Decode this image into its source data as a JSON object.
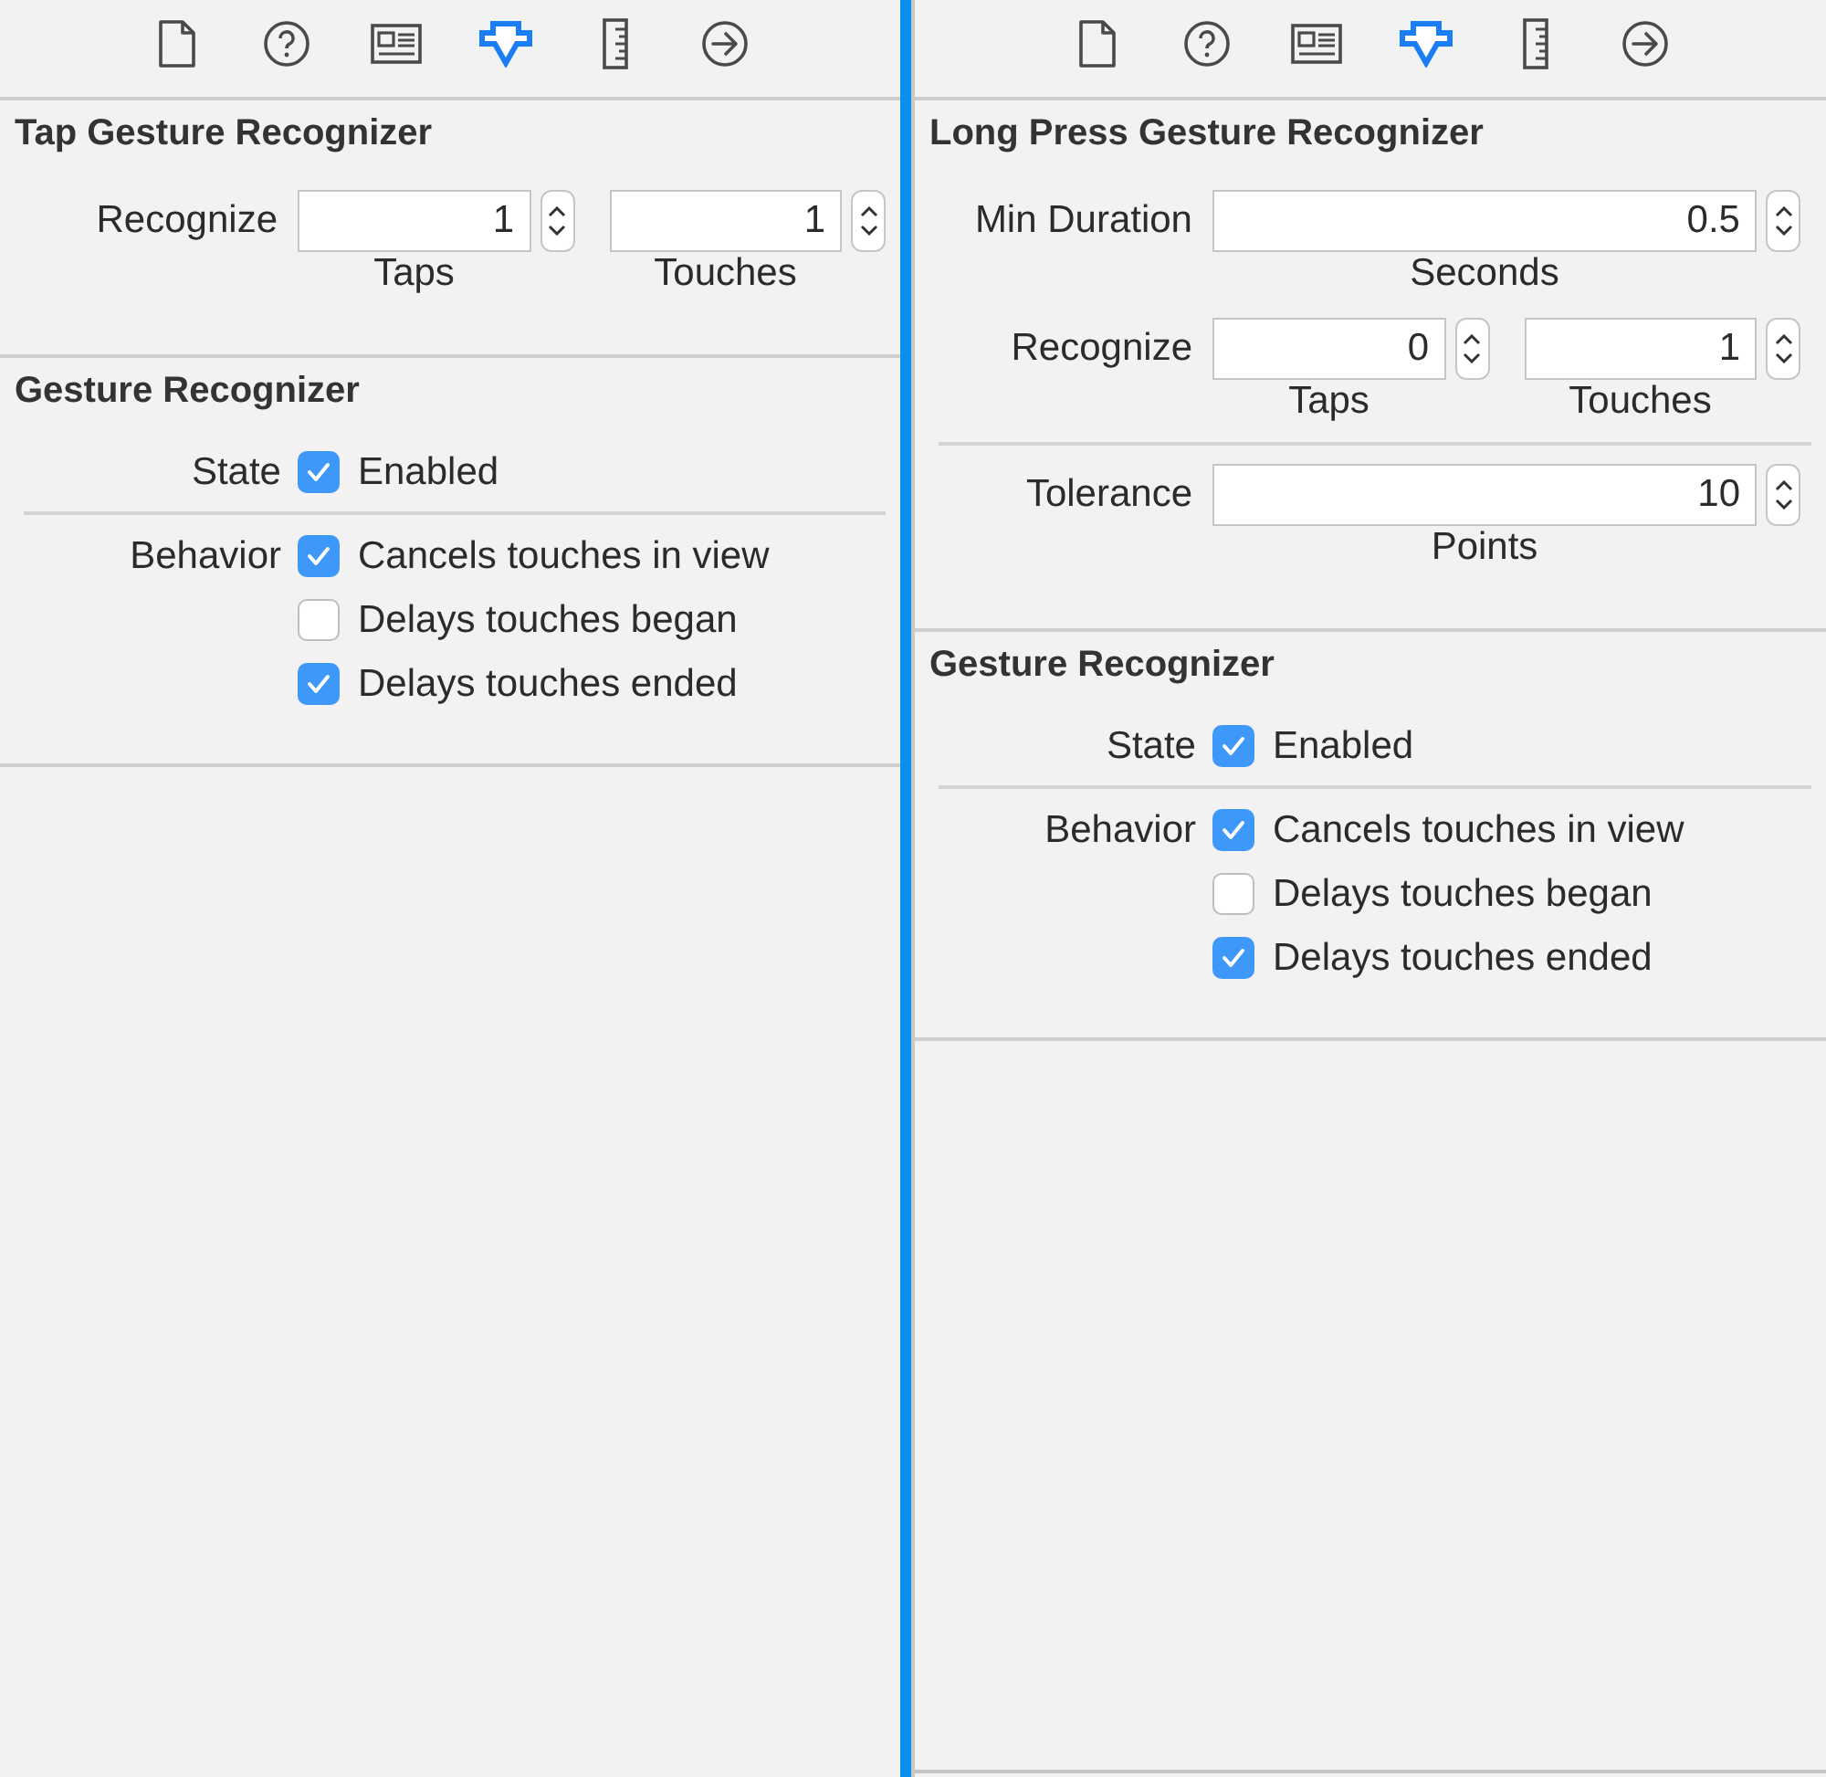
{
  "panels": [
    {
      "toolbar": [
        {
          "kind": "document",
          "selected": false
        },
        {
          "kind": "help",
          "selected": false
        },
        {
          "kind": "identity",
          "selected": false
        },
        {
          "kind": "attributes",
          "selected": true
        },
        {
          "kind": "size",
          "selected": false
        },
        {
          "kind": "connections",
          "selected": false
        }
      ],
      "sections": [
        {
          "title": "Tap Gesture Recognizer",
          "rows": [
            {
              "kind": "fields",
              "label": "Recognize",
              "fields": [
                {
                  "value": "1",
                  "caption": "Taps"
                },
                {
                  "value": "1",
                  "caption": "Touches"
                }
              ]
            }
          ]
        },
        {
          "title": "Gesture Recognizer",
          "rows": [
            {
              "kind": "checks",
              "label": "State",
              "items": [
                {
                  "label": "Enabled",
                  "checked": true
                }
              ]
            },
            {
              "kind": "separator"
            },
            {
              "kind": "checks",
              "label": "Behavior",
              "items": [
                {
                  "label": "Cancels touches in view",
                  "checked": true
                },
                {
                  "label": "Delays touches began",
                  "checked": false
                },
                {
                  "label": "Delays touches ended",
                  "checked": true
                }
              ]
            }
          ]
        }
      ]
    },
    {
      "toolbar": [
        {
          "kind": "document",
          "selected": false
        },
        {
          "kind": "help",
          "selected": false
        },
        {
          "kind": "identity",
          "selected": false
        },
        {
          "kind": "attributes",
          "selected": true
        },
        {
          "kind": "size",
          "selected": false
        },
        {
          "kind": "connections",
          "selected": false
        }
      ],
      "sections": [
        {
          "title": "Long Press Gesture Recognizer",
          "rows": [
            {
              "kind": "fields",
              "label": "Min Duration",
              "fields": [
                {
                  "value": "0.5",
                  "caption": "Seconds"
                }
              ]
            },
            {
              "kind": "fields",
              "label": "Recognize",
              "fields": [
                {
                  "value": "0",
                  "caption": "Taps"
                },
                {
                  "value": "1",
                  "caption": "Touches"
                }
              ]
            },
            {
              "kind": "separator"
            },
            {
              "kind": "fields",
              "label": "Tolerance",
              "fields": [
                {
                  "value": "10",
                  "caption": "Points"
                }
              ]
            }
          ]
        },
        {
          "title": "Gesture Recognizer",
          "rows": [
            {
              "kind": "checks",
              "label": "State",
              "items": [
                {
                  "label": "Enabled",
                  "checked": true
                }
              ]
            },
            {
              "kind": "separator"
            },
            {
              "kind": "checks",
              "label": "Behavior",
              "items": [
                {
                  "label": "Cancels touches in view",
                  "checked": true
                },
                {
                  "label": "Delays touches began",
                  "checked": false
                },
                {
                  "label": "Delays touches ended",
                  "checked": true
                }
              ]
            }
          ]
        }
      ]
    }
  ]
}
